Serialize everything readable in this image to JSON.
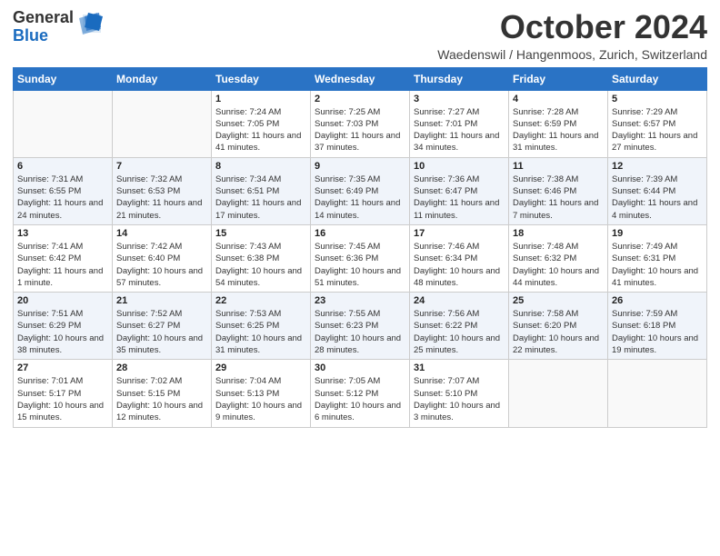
{
  "header": {
    "logo_general": "General",
    "logo_blue": "Blue",
    "month_title": "October 2024",
    "location": "Waedenswil / Hangenmoos, Zurich, Switzerland"
  },
  "days_of_week": [
    "Sunday",
    "Monday",
    "Tuesday",
    "Wednesday",
    "Thursday",
    "Friday",
    "Saturday"
  ],
  "weeks": [
    [
      {
        "day": "",
        "info": ""
      },
      {
        "day": "",
        "info": ""
      },
      {
        "day": "1",
        "info": "Sunrise: 7:24 AM\nSunset: 7:05 PM\nDaylight: 11 hours and 41 minutes."
      },
      {
        "day": "2",
        "info": "Sunrise: 7:25 AM\nSunset: 7:03 PM\nDaylight: 11 hours and 37 minutes."
      },
      {
        "day": "3",
        "info": "Sunrise: 7:27 AM\nSunset: 7:01 PM\nDaylight: 11 hours and 34 minutes."
      },
      {
        "day": "4",
        "info": "Sunrise: 7:28 AM\nSunset: 6:59 PM\nDaylight: 11 hours and 31 minutes."
      },
      {
        "day": "5",
        "info": "Sunrise: 7:29 AM\nSunset: 6:57 PM\nDaylight: 11 hours and 27 minutes."
      }
    ],
    [
      {
        "day": "6",
        "info": "Sunrise: 7:31 AM\nSunset: 6:55 PM\nDaylight: 11 hours and 24 minutes."
      },
      {
        "day": "7",
        "info": "Sunrise: 7:32 AM\nSunset: 6:53 PM\nDaylight: 11 hours and 21 minutes."
      },
      {
        "day": "8",
        "info": "Sunrise: 7:34 AM\nSunset: 6:51 PM\nDaylight: 11 hours and 17 minutes."
      },
      {
        "day": "9",
        "info": "Sunrise: 7:35 AM\nSunset: 6:49 PM\nDaylight: 11 hours and 14 minutes."
      },
      {
        "day": "10",
        "info": "Sunrise: 7:36 AM\nSunset: 6:47 PM\nDaylight: 11 hours and 11 minutes."
      },
      {
        "day": "11",
        "info": "Sunrise: 7:38 AM\nSunset: 6:46 PM\nDaylight: 11 hours and 7 minutes."
      },
      {
        "day": "12",
        "info": "Sunrise: 7:39 AM\nSunset: 6:44 PM\nDaylight: 11 hours and 4 minutes."
      }
    ],
    [
      {
        "day": "13",
        "info": "Sunrise: 7:41 AM\nSunset: 6:42 PM\nDaylight: 11 hours and 1 minute."
      },
      {
        "day": "14",
        "info": "Sunrise: 7:42 AM\nSunset: 6:40 PM\nDaylight: 10 hours and 57 minutes."
      },
      {
        "day": "15",
        "info": "Sunrise: 7:43 AM\nSunset: 6:38 PM\nDaylight: 10 hours and 54 minutes."
      },
      {
        "day": "16",
        "info": "Sunrise: 7:45 AM\nSunset: 6:36 PM\nDaylight: 10 hours and 51 minutes."
      },
      {
        "day": "17",
        "info": "Sunrise: 7:46 AM\nSunset: 6:34 PM\nDaylight: 10 hours and 48 minutes."
      },
      {
        "day": "18",
        "info": "Sunrise: 7:48 AM\nSunset: 6:32 PM\nDaylight: 10 hours and 44 minutes."
      },
      {
        "day": "19",
        "info": "Sunrise: 7:49 AM\nSunset: 6:31 PM\nDaylight: 10 hours and 41 minutes."
      }
    ],
    [
      {
        "day": "20",
        "info": "Sunrise: 7:51 AM\nSunset: 6:29 PM\nDaylight: 10 hours and 38 minutes."
      },
      {
        "day": "21",
        "info": "Sunrise: 7:52 AM\nSunset: 6:27 PM\nDaylight: 10 hours and 35 minutes."
      },
      {
        "day": "22",
        "info": "Sunrise: 7:53 AM\nSunset: 6:25 PM\nDaylight: 10 hours and 31 minutes."
      },
      {
        "day": "23",
        "info": "Sunrise: 7:55 AM\nSunset: 6:23 PM\nDaylight: 10 hours and 28 minutes."
      },
      {
        "day": "24",
        "info": "Sunrise: 7:56 AM\nSunset: 6:22 PM\nDaylight: 10 hours and 25 minutes."
      },
      {
        "day": "25",
        "info": "Sunrise: 7:58 AM\nSunset: 6:20 PM\nDaylight: 10 hours and 22 minutes."
      },
      {
        "day": "26",
        "info": "Sunrise: 7:59 AM\nSunset: 6:18 PM\nDaylight: 10 hours and 19 minutes."
      }
    ],
    [
      {
        "day": "27",
        "info": "Sunrise: 7:01 AM\nSunset: 5:17 PM\nDaylight: 10 hours and 15 minutes."
      },
      {
        "day": "28",
        "info": "Sunrise: 7:02 AM\nSunset: 5:15 PM\nDaylight: 10 hours and 12 minutes."
      },
      {
        "day": "29",
        "info": "Sunrise: 7:04 AM\nSunset: 5:13 PM\nDaylight: 10 hours and 9 minutes."
      },
      {
        "day": "30",
        "info": "Sunrise: 7:05 AM\nSunset: 5:12 PM\nDaylight: 10 hours and 6 minutes."
      },
      {
        "day": "31",
        "info": "Sunrise: 7:07 AM\nSunset: 5:10 PM\nDaylight: 10 hours and 3 minutes."
      },
      {
        "day": "",
        "info": ""
      },
      {
        "day": "",
        "info": ""
      }
    ]
  ]
}
